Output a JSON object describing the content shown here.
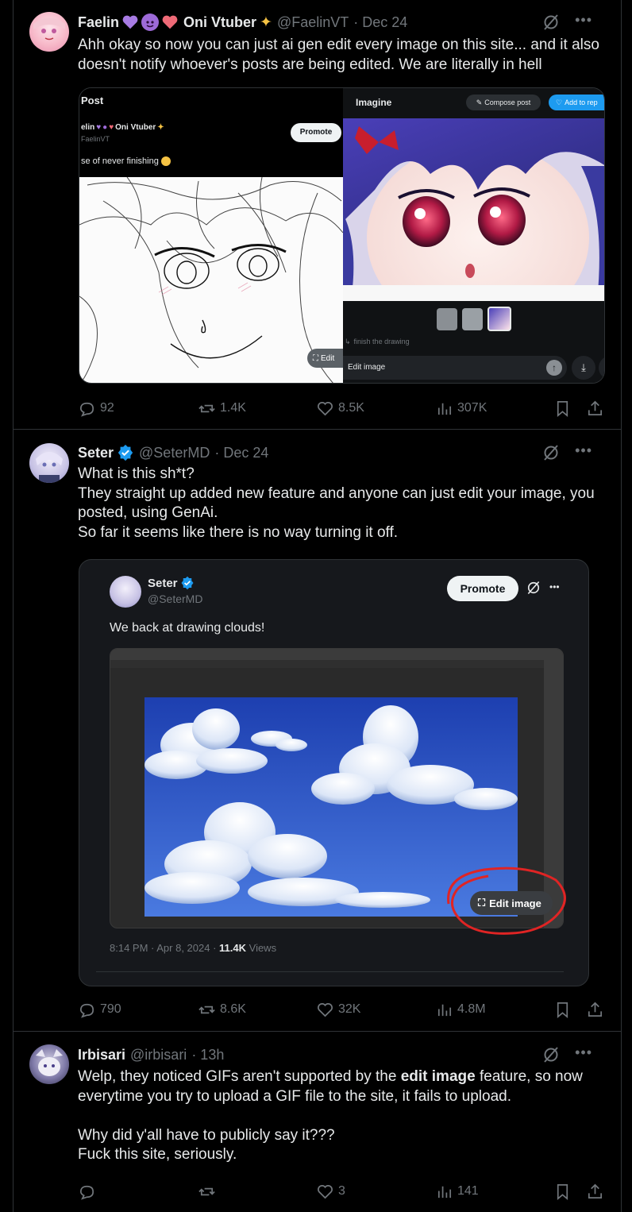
{
  "tweets": [
    {
      "name": "Faelin",
      "name_suffix": "Oni Vtuber",
      "handle": "@FaelinVT",
      "date": "· Dec 24",
      "text": [
        "Ahh okay so now you can just ai gen edit every image on this site... and it also doesn't notify whoever's posts are being edited. We are literally in hell"
      ],
      "media": {
        "left_panel": {
          "title": "Post",
          "user": "elin",
          "user_suffix": "Oni Vtuber",
          "handle": "FaelinVT",
          "promote": "Promote",
          "caption": "se of never finishing",
          "edit": "Edit"
        },
        "right_panel": {
          "title": "Imagine",
          "compose": "Compose post",
          "add_to_reply": "Add to rep",
          "prompt": "finish the drawing",
          "input_placeholder": "Edit image"
        }
      },
      "stats": {
        "replies": "92",
        "reposts": "1.4K",
        "likes": "8.5K",
        "views": "307K"
      }
    },
    {
      "name": "Seter",
      "handle": "@SeterMD",
      "date": "· Dec 24",
      "text": [
        "What is this sh*t?",
        "They straight up added new feature and anyone can just edit your image, you posted, using GenAi.",
        "So far it seems like there is no way turning it off."
      ],
      "quote": {
        "name": "Seter",
        "handle": "@SeterMD",
        "promote": "Promote",
        "text": "We back at drawing clouds!",
        "edit_image": "Edit image",
        "timestamp": "8:14 PM · Apr 8, 2024 · ",
        "views_count": "11.4K",
        "views_label": " Views"
      },
      "stats": {
        "replies": "790",
        "reposts": "8.6K",
        "likes": "32K",
        "views": "4.8M"
      }
    },
    {
      "name": "Irbisari",
      "handle": "@irbisari",
      "date": "· 13h",
      "text_a": "Welp, they noticed GIFs aren't supported by the ",
      "text_bold": "edit image",
      "text_b": " feature, so now everytime you try to upload a GIF file to the site, it fails to upload.",
      "text_c": "Why did y'all have to publicly say it???",
      "text_d": "Fuck this site, seriously.",
      "stats": {
        "replies": "",
        "reposts": "",
        "likes": "3",
        "views": "141"
      }
    }
  ],
  "colors": {
    "background": "#000000",
    "text": "#e7e9ea",
    "muted": "#71767b",
    "border": "#2f3336",
    "verified": "#1d9bf0",
    "annotation": "#e02424"
  }
}
